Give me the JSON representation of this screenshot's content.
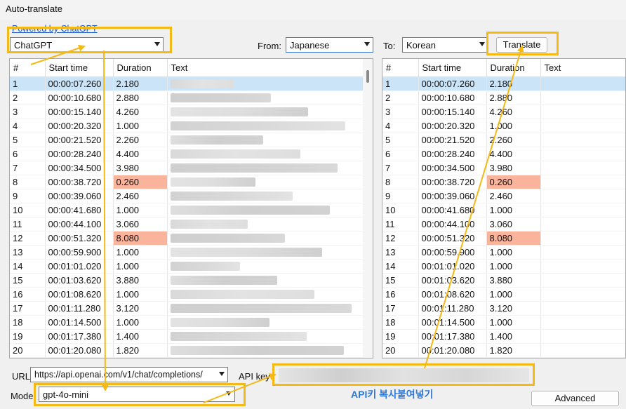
{
  "window": {
    "title": "Auto-translate"
  },
  "engine": {
    "powered_by": "Powered by ChatGPT",
    "selected": "ChatGPT"
  },
  "from": {
    "label": "From:",
    "value": "Japanese"
  },
  "to": {
    "label": "To:",
    "value": "Korean"
  },
  "translate_button": "Translate",
  "columns": {
    "num": "#",
    "start": "Start time",
    "duration": "Duration",
    "text": "Text"
  },
  "rows": [
    {
      "num": "1",
      "start": "00:00:07.260",
      "dur": "2.180",
      "warn": false,
      "selected": true
    },
    {
      "num": "2",
      "start": "00:00:10.680",
      "dur": "2.880",
      "warn": false,
      "selected": false
    },
    {
      "num": "3",
      "start": "00:00:15.140",
      "dur": "4.260",
      "warn": false,
      "selected": false
    },
    {
      "num": "4",
      "start": "00:00:20.320",
      "dur": "1.000",
      "warn": false,
      "selected": false
    },
    {
      "num": "5",
      "start": "00:00:21.520",
      "dur": "2.260",
      "warn": false,
      "selected": false
    },
    {
      "num": "6",
      "start": "00:00:28.240",
      "dur": "4.400",
      "warn": false,
      "selected": false
    },
    {
      "num": "7",
      "start": "00:00:34.500",
      "dur": "3.980",
      "warn": false,
      "selected": false
    },
    {
      "num": "8",
      "start": "00:00:38.720",
      "dur": "0.260",
      "warn": true,
      "selected": false
    },
    {
      "num": "9",
      "start": "00:00:39.060",
      "dur": "2.460",
      "warn": false,
      "selected": false
    },
    {
      "num": "10",
      "start": "00:00:41.680",
      "dur": "1.000",
      "warn": false,
      "selected": false
    },
    {
      "num": "11",
      "start": "00:00:44.100",
      "dur": "3.060",
      "warn": false,
      "selected": false
    },
    {
      "num": "12",
      "start": "00:00:51.320",
      "dur": "8.080",
      "warn": true,
      "selected": false
    },
    {
      "num": "13",
      "start": "00:00:59.900",
      "dur": "1.000",
      "warn": false,
      "selected": false
    },
    {
      "num": "14",
      "start": "00:01:01.020",
      "dur": "1.000",
      "warn": false,
      "selected": false
    },
    {
      "num": "15",
      "start": "00:01:03.620",
      "dur": "3.880",
      "warn": false,
      "selected": false
    },
    {
      "num": "16",
      "start": "00:01:08.620",
      "dur": "1.000",
      "warn": false,
      "selected": false
    },
    {
      "num": "17",
      "start": "00:01:11.280",
      "dur": "3.120",
      "warn": false,
      "selected": false
    },
    {
      "num": "18",
      "start": "00:01:14.500",
      "dur": "1.000",
      "warn": false,
      "selected": false
    },
    {
      "num": "19",
      "start": "00:01:17.380",
      "dur": "1.400",
      "warn": false,
      "selected": false
    },
    {
      "num": "20",
      "start": "00:01:20.080",
      "dur": "1.820",
      "warn": false,
      "selected": false
    }
  ],
  "url": {
    "label": "URL",
    "value": "https://api.openai.com/v1/chat/completions/"
  },
  "api_key": {
    "label": "API key"
  },
  "model": {
    "label": "Model",
    "value": "gpt-4o-mini"
  },
  "annotation": "API키 복사붙여넣기",
  "advanced_button": "Advanced",
  "colors": {
    "highlight": "#f5b915",
    "warn": "#f9b49b",
    "selected_row": "#cce4f7",
    "annotation_text": "#2e78d6"
  }
}
